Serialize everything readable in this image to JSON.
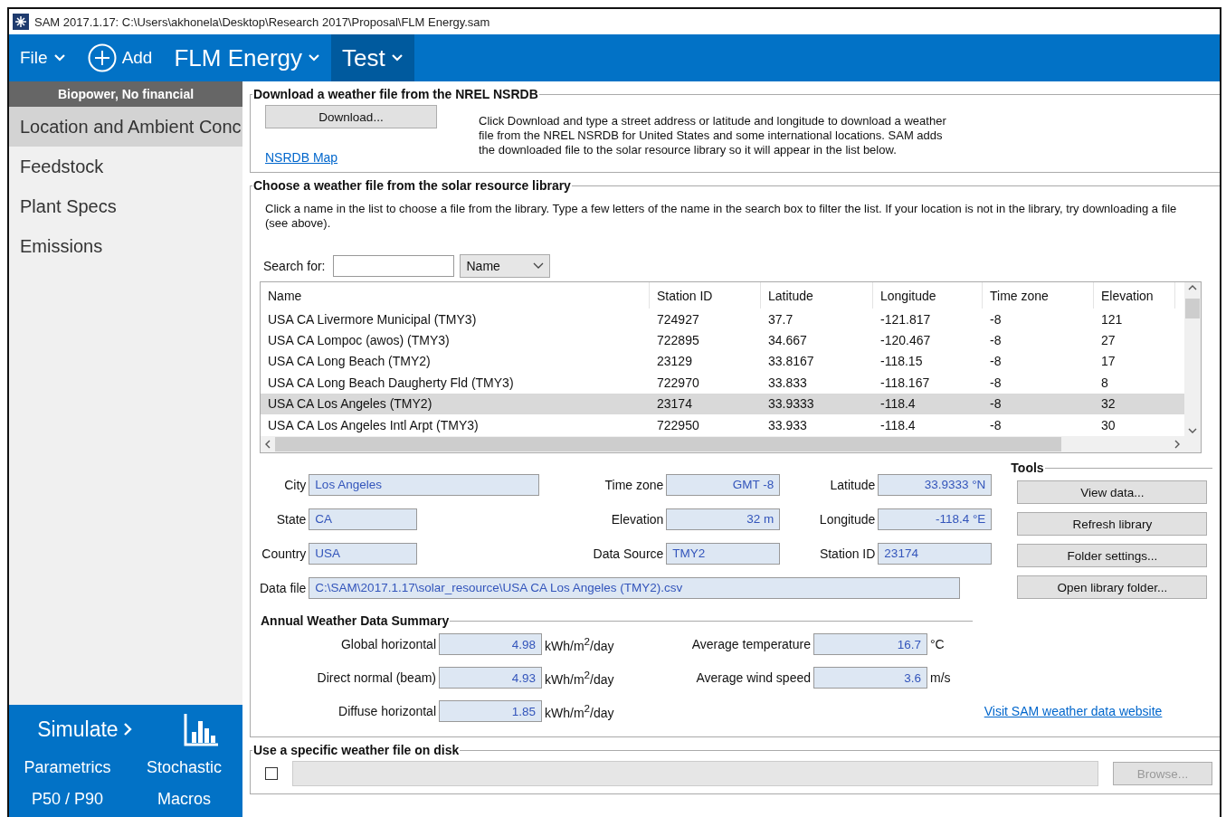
{
  "window": {
    "title": "SAM 2017.1.17: C:\\Users\\akhonela\\Desktop\\Research 2017\\Proposal\\FLM Energy.sam"
  },
  "toolbar": [
    {
      "label": "File",
      "kind": "menu",
      "selected": false
    },
    {
      "label": "Add",
      "kind": "add",
      "selected": false
    },
    {
      "label": "FLM Energy",
      "kind": "case",
      "selected": false
    },
    {
      "label": "Test",
      "kind": "case",
      "selected": true
    }
  ],
  "sidebar": {
    "header": "Biopower, No financial",
    "items": [
      {
        "label": "Location and Ambient Conc",
        "selected": true
      },
      {
        "label": "Feedstock",
        "selected": false
      },
      {
        "label": "Plant Specs",
        "selected": false
      },
      {
        "label": "Emissions",
        "selected": false
      }
    ],
    "simulate": "Simulate",
    "tools": [
      "Parametrics",
      "Stochastic",
      "P50 / P90",
      "Macros"
    ]
  },
  "download_section": {
    "title": "Download a weather file from the NREL NSRDB",
    "button": "Download...",
    "link": "NSRDB Map",
    "description": "Click Download and type a street address or latitude and longitude to download a weather file from the NREL NSRDB for United States and some international locations. SAM adds the downloaded file to the solar resource library so it will appear in the list below."
  },
  "library_section": {
    "title": "Choose a weather file from the solar resource library",
    "instructions": "Click a name in the list to choose a file from the library. Type a few letters of the name in the search box to filter the list.  If your location is not in the library, try downloading a file (see above).",
    "search_label": "Search for:",
    "search_by": "Name",
    "table": {
      "columns": [
        "Name",
        "Station ID",
        "Latitude",
        "Longitude",
        "Time zone",
        "Elevation"
      ],
      "rows": [
        {
          "cells": [
            "USA CA Livermore Municipal (TMY3)",
            "724927",
            "37.7",
            "-121.817",
            "-8",
            "121"
          ],
          "selected": false
        },
        {
          "cells": [
            "USA CA Lompoc (awos) (TMY3)",
            "722895",
            "34.667",
            "-120.467",
            "-8",
            "27"
          ],
          "selected": false
        },
        {
          "cells": [
            "USA CA Long Beach (TMY2)",
            "23129",
            "33.8167",
            "-118.15",
            "-8",
            "17"
          ],
          "selected": false
        },
        {
          "cells": [
            "USA CA Long Beach Daugherty Fld (TMY3)",
            "722970",
            "33.833",
            "-118.167",
            "-8",
            "8"
          ],
          "selected": false
        },
        {
          "cells": [
            "USA CA Los Angeles (TMY2)",
            "23174",
            "33.9333",
            "-118.4",
            "-8",
            "32"
          ],
          "selected": true
        },
        {
          "cells": [
            "USA CA Los Angeles Intl Arpt (TMY3)",
            "722950",
            "33.933",
            "-118.4",
            "-8",
            "30"
          ],
          "selected": false
        }
      ]
    },
    "location": [
      {
        "label": "City",
        "value": "Los Angeles",
        "kind": "text"
      },
      {
        "label": "Time zone",
        "value": "GMT -8",
        "kind": "number"
      },
      {
        "label": "Latitude",
        "value": "33.9333 °N",
        "kind": "number"
      },
      {
        "label": "State",
        "value": "CA",
        "kind": "short"
      },
      {
        "label": "Elevation",
        "value": "32 m",
        "kind": "number"
      },
      {
        "label": "Longitude",
        "value": "-118.4 °E",
        "kind": "number"
      },
      {
        "label": "Country",
        "value": "USA",
        "kind": "short"
      },
      {
        "label": "Data Source",
        "value": "TMY2",
        "kind": "text"
      },
      {
        "label": "Station ID",
        "value": "23174",
        "kind": "text"
      }
    ],
    "data_file": {
      "label": "Data file",
      "value": "C:\\SAM\\2017.1.17\\solar_resource\\USA CA Los Angeles (TMY2).csv"
    },
    "tools": {
      "title": "Tools",
      "buttons": [
        "View data...",
        "Refresh library",
        "Folder settings...",
        "Open library folder..."
      ]
    },
    "summary": {
      "title": "Annual Weather Data Summary",
      "items": [
        {
          "label": "Global horizontal",
          "value": "4.98",
          "unit": "kWh/m$^{2}$/day"
        },
        {
          "label": "Average temperature",
          "value": "16.7",
          "unit": "°C"
        },
        {
          "label": "Direct normal (beam)",
          "value": "4.93",
          "unit": "kWh/m$^{2}$/day"
        },
        {
          "label": "Average wind speed",
          "value": "3.6",
          "unit": "m/s"
        },
        {
          "label": "Diffuse horizontal",
          "value": "1.85",
          "unit": "kWh/m$^{2}$/day"
        }
      ],
      "link": "Visit SAM weather data website"
    }
  },
  "disk_section": {
    "title": "Use a specific weather file on disk",
    "checked": false,
    "browse": "Browse...",
    "browse_disabled": true
  }
}
